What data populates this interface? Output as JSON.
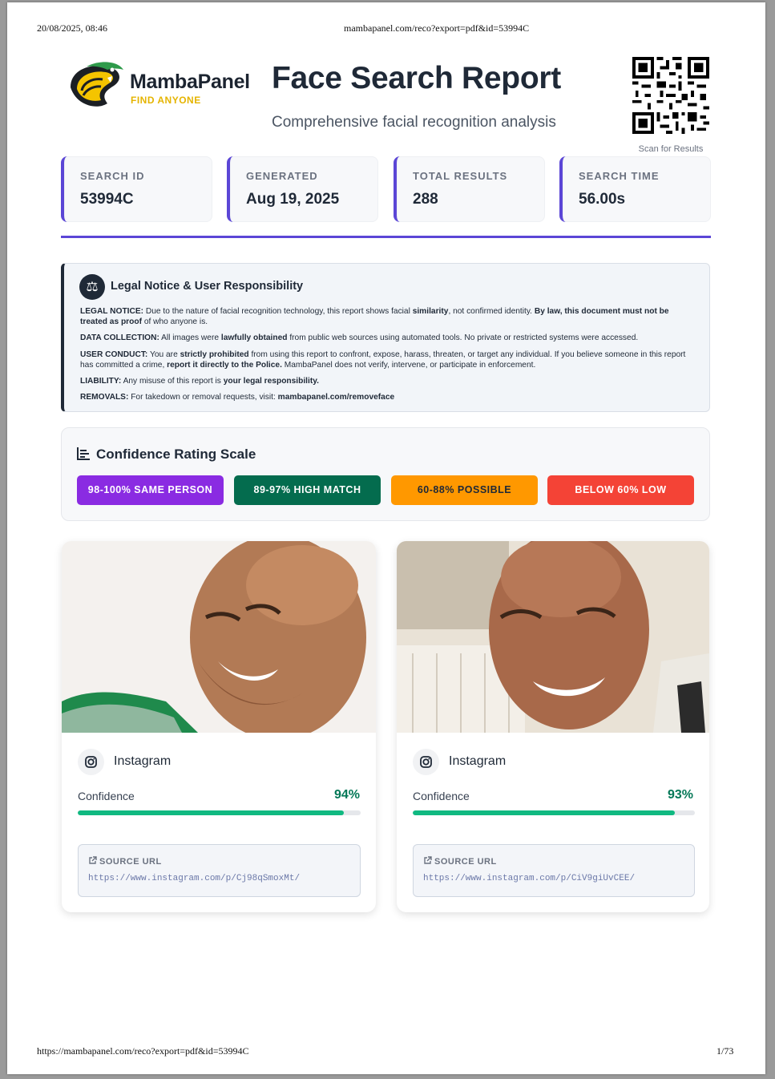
{
  "print_header": {
    "datetime": "20/08/2025, 08:46",
    "url": "mambapanel.com/reco?export=pdf&id=53994C"
  },
  "print_footer": {
    "url": "https://mambapanel.com/reco?export=pdf&id=53994C",
    "page": "1/73"
  },
  "brand": {
    "name": "MambaPanel",
    "tagline": "FIND ANYONE",
    "accent": "#e5b400",
    "primary": "#5b46d6"
  },
  "report": {
    "title": "Face Search Report",
    "subtitle": "Comprehensive facial recognition analysis",
    "qr_caption": "Scan for Results"
  },
  "stats": [
    {
      "label": "SEARCH ID",
      "value": "53994C"
    },
    {
      "label": "GENERATED",
      "value": "Aug 19, 2025"
    },
    {
      "label": "TOTAL RESULTS",
      "value": "288"
    },
    {
      "label": "SEARCH TIME",
      "value": "56.00s"
    }
  ],
  "legal": {
    "title": "Legal Notice & User Responsibility",
    "icon": "scales-icon",
    "paragraphs": [
      {
        "label": "LEGAL NOTICE:",
        "segments": [
          {
            "t": " Due to the nature of facial recognition technology, this report shows facial "
          },
          {
            "t": "similarity",
            "b": true
          },
          {
            "t": ", not confirmed identity. "
          },
          {
            "t": "By law, this document must not be treated as proof",
            "b": true
          },
          {
            "t": " of who anyone is."
          }
        ]
      },
      {
        "label": "DATA COLLECTION:",
        "segments": [
          {
            "t": " All images were "
          },
          {
            "t": "lawfully obtained",
            "b": true
          },
          {
            "t": " from public web sources using automated tools. No private or restricted systems were accessed."
          }
        ]
      },
      {
        "label": "USER CONDUCT:",
        "segments": [
          {
            "t": " You are "
          },
          {
            "t": "strictly prohibited",
            "b": true
          },
          {
            "t": " from using this report to confront, expose, harass, threaten, or target any individual. If you believe someone in this report has committed a crime, "
          },
          {
            "t": "report it directly to the Police.",
            "b": true
          },
          {
            "t": " MambaPanel does not verify, intervene, or participate in enforcement."
          }
        ]
      },
      {
        "label": "LIABILITY:",
        "segments": [
          {
            "t": " Any misuse of this report is "
          },
          {
            "t": "your legal responsibility.",
            "b": true
          }
        ]
      },
      {
        "label": "REMOVALS:",
        "segments": [
          {
            "t": " For takedown or removal requests, visit: "
          },
          {
            "t": "mambapanel.com/removeface",
            "b": true
          }
        ]
      }
    ]
  },
  "scale": {
    "title": "Confidence Rating Scale",
    "icon": "bar-chart-icon",
    "badges": [
      {
        "label": "98-100% SAME PERSON",
        "bg": "#8a2be2",
        "fg": "#ffffff"
      },
      {
        "label": "89-97% HIGH MATCH",
        "bg": "#046c4e",
        "fg": "#ffffff"
      },
      {
        "label": "60-88% POSSIBLE",
        "bg": "#ff9800",
        "fg": "#1f2937"
      },
      {
        "label": "BELOW 60% LOW",
        "bg": "#f44336",
        "fg": "#ffffff"
      }
    ]
  },
  "results": [
    {
      "platform": "Instagram",
      "icon": "instagram-icon",
      "confidence_label": "Confidence",
      "confidence": "94%",
      "confidence_fraction": 0.94,
      "source_label": "SOURCE URL",
      "url": "https://www.instagram.com/p/Cj98qSmoxMt/"
    },
    {
      "platform": "Instagram",
      "icon": "instagram-icon",
      "confidence_label": "Confidence",
      "confidence": "93%",
      "confidence_fraction": 0.93,
      "source_label": "SOURCE URL",
      "url": "https://www.instagram.com/p/CiV9giUvCEE/"
    }
  ]
}
